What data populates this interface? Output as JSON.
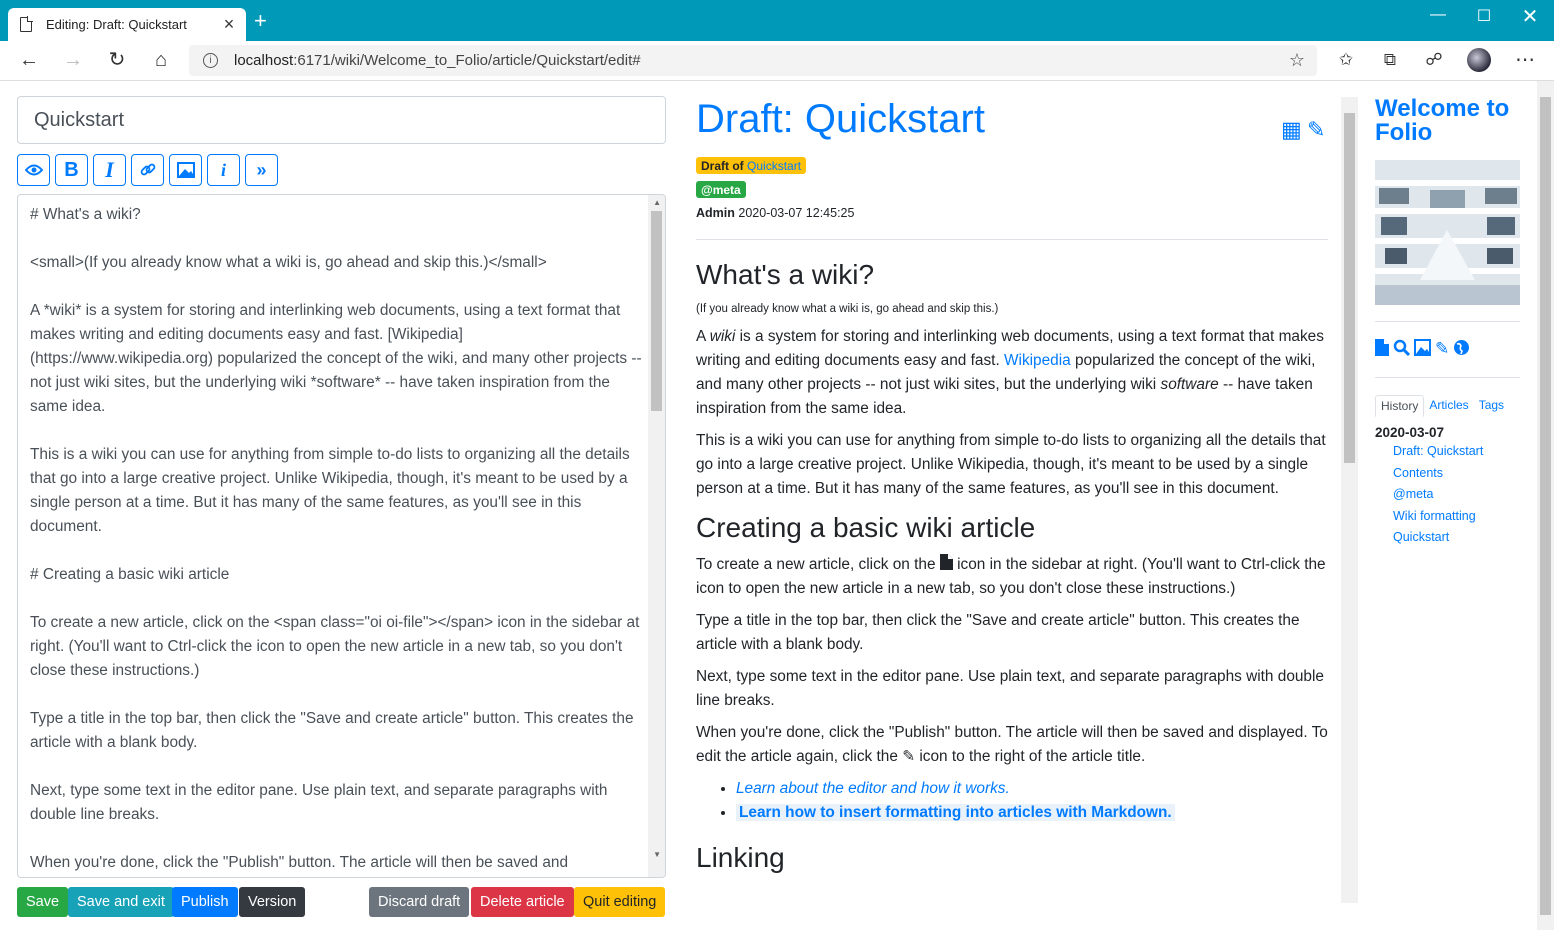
{
  "browser": {
    "tab_title": "Editing: Draft: Quickstart",
    "url_host": "localhost",
    "url_rest": ":6171/wiki/Welcome_to_Folio/article/Quickstart/edit#"
  },
  "editor": {
    "title_value": "Quickstart",
    "format_buttons": [
      "preview-icon",
      "bold-icon",
      "italic-icon",
      "link-icon",
      "image-icon",
      "info-icon",
      "more-icon"
    ],
    "lines": [
      "# What's a wiki?",
      "<small>(If you already know what a wiki is, go ahead and skip this.)</small>",
      "A *wiki* is a system for storing and interlinking web documents, using a text format that makes writing and editing documents easy and fast.  [Wikipedia](https://www.wikipedia.org) popularized the concept of the wiki, and many other projects -- not just wiki sites, but the underlying wiki *software* -- have taken inspiration from the same idea.",
      "This is a wiki you can use for anything from simple to-do lists to organizing all the details that go into a large creative project. Unlike Wikipedia, though, it's meant to be used by a single person at a time. But it has many of the same features, as you'll see in this document.",
      "# Creating a basic wiki article",
      "To create a new article, click on the <span class=\"oi oi-file\"></span> icon in the sidebar at right. (You'll want to Ctrl-click the icon to open the new article in a new tab, so you don't close these instructions.)",
      "Type a title in the top bar, then click the \"Save and create article\" button. This creates the article with a blank body.",
      "Next, type some text in the editor pane. Use plain text, and separate paragraphs with double line breaks.",
      "When you're done, click the \"Publish\" button. The article will then be saved and"
    ]
  },
  "buttons": {
    "save": "Save",
    "save_exit": "Save and exit",
    "publish": "Publish",
    "version": "Version",
    "discard": "Discard draft",
    "delete": "Delete article",
    "quit": "Quit editing"
  },
  "colors": {
    "chrome": "#0099b8",
    "primary": "#007bff",
    "success": "#28a745",
    "info": "#17a2b8",
    "dark": "#343a40",
    "secondary": "#6c757d",
    "danger": "#dc3545",
    "warning": "#ffc107"
  },
  "preview": {
    "title": "Draft: Quickstart",
    "draft_badge_prefix": "Draft of",
    "draft_badge_link": "Quickstart",
    "meta_badge": "@meta",
    "author": "Admin",
    "timestamp": "2020-03-07 12:45:25",
    "h_wiki": "What's a wiki?",
    "small_note": "(If you already know what a wiki is, go ahead and skip this.)",
    "p1_a": "A",
    "p1_wiki": "wiki",
    "p1_b": "is a system for storing and interlinking web documents, using a text format that makes writing and editing documents easy and fast.",
    "p1_link": "Wikipedia",
    "p1_c": "popularized the concept of the wiki, and many other projects -- not just wiki sites, but the underlying wiki",
    "p1_software": "software",
    "p1_d": "-- have taken inspiration from the same idea.",
    "p2": "This is a wiki you can use for anything from simple to-do lists to organizing all the details that go into a large creative project. Unlike Wikipedia, though, it's meant to be used by a single person at a time. But it has many of the same features, as you'll see in this document.",
    "h_create": "Creating a basic wiki article",
    "p3_a": "To create a new article, click on the",
    "p3_b": "icon in the sidebar at right. (You'll want to Ctrl-click the icon to open the new article in a new tab, so you don't close these instructions.)",
    "p4": "Type a title in the top bar, then click the \"Save and create article\" button. This creates the article with a blank body.",
    "p5": "Next, type some text in the editor pane. Use plain text, and separate paragraphs with double line breaks.",
    "p6_a": "When you're done, click the \"Publish\" button. The article will then be saved and displayed. To edit the article again, click the",
    "p6_b": "icon to the right of the article title.",
    "li1": "Learn about the editor and how it works.",
    "li2": "Learn how to insert formatting into articles with Markdown.",
    "h_linking": "Linking"
  },
  "sidebar": {
    "wiki_title": "Welcome to Folio",
    "tabs": [
      "History",
      "Articles",
      "Tags"
    ],
    "history_date": "2020-03-07",
    "history_items": [
      "Draft: Quickstart",
      "Contents",
      "@meta",
      "Wiki formatting",
      "Quickstart"
    ]
  }
}
